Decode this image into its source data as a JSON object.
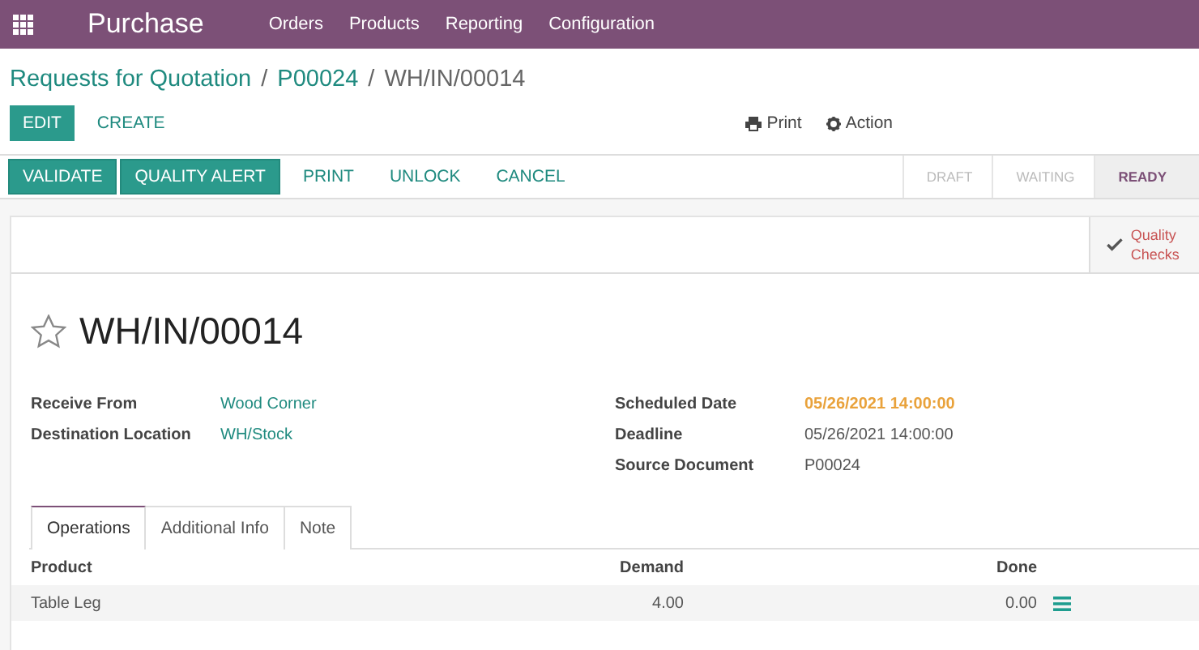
{
  "navbar": {
    "app_name": "Purchase",
    "menu": [
      "Orders",
      "Products",
      "Reporting",
      "Configuration"
    ]
  },
  "breadcrumb": [
    {
      "label": "Requests for Quotation",
      "kind": "link"
    },
    {
      "label": "/",
      "kind": "separator"
    },
    {
      "label": "P00024",
      "kind": "link"
    },
    {
      "label": "/",
      "kind": "separator"
    },
    {
      "label": "WH/IN/00014",
      "kind": "current"
    }
  ],
  "control_buttons": [
    {
      "label": "EDIT",
      "kind": "primary"
    },
    {
      "label": "CREATE",
      "kind": "link"
    }
  ],
  "sidebar_actions": [
    {
      "label": "Print",
      "kind": "print"
    },
    {
      "label": "Action",
      "kind": "gear"
    }
  ],
  "action_buttons": [
    {
      "label": "VALIDATE",
      "kind": "primary"
    },
    {
      "label": "QUALITY ALERT",
      "kind": "primary"
    },
    {
      "label": "PRINT",
      "kind": "link"
    },
    {
      "label": "UNLOCK",
      "kind": "link"
    },
    {
      "label": "CANCEL",
      "kind": "link"
    }
  ],
  "status_steps": [
    {
      "label": "DRAFT",
      "selected": false
    },
    {
      "label": "WAITING",
      "selected": false
    },
    {
      "label": "READY",
      "selected": true
    }
  ],
  "smart_button": {
    "label": "Quality Checks"
  },
  "record": {
    "title": "WH/IN/00014",
    "starred": false
  },
  "left_fields": [
    {
      "label": "Receive From",
      "value": "Wood Corner",
      "link": true
    },
    {
      "label": "Destination Location",
      "value": "WH/Stock",
      "link": true
    }
  ],
  "right_fields": [
    {
      "label": "Scheduled Date",
      "value": "05/26/2021 14:00:00",
      "warning": true
    },
    {
      "label": "Deadline",
      "value": "05/26/2021 14:00:00",
      "warning": false
    },
    {
      "label": "Source Document",
      "value": "P00024",
      "warning": false
    }
  ],
  "tabs": [
    {
      "label": "Operations",
      "selected": true
    },
    {
      "label": "Additional Info",
      "selected": false
    },
    {
      "label": "Note",
      "selected": false
    }
  ],
  "table": {
    "columns": [
      "Product",
      "Demand",
      "Done"
    ],
    "rows": [
      {
        "product": "Table Leg",
        "demand": "4.00",
        "done": "0.00"
      }
    ]
  }
}
